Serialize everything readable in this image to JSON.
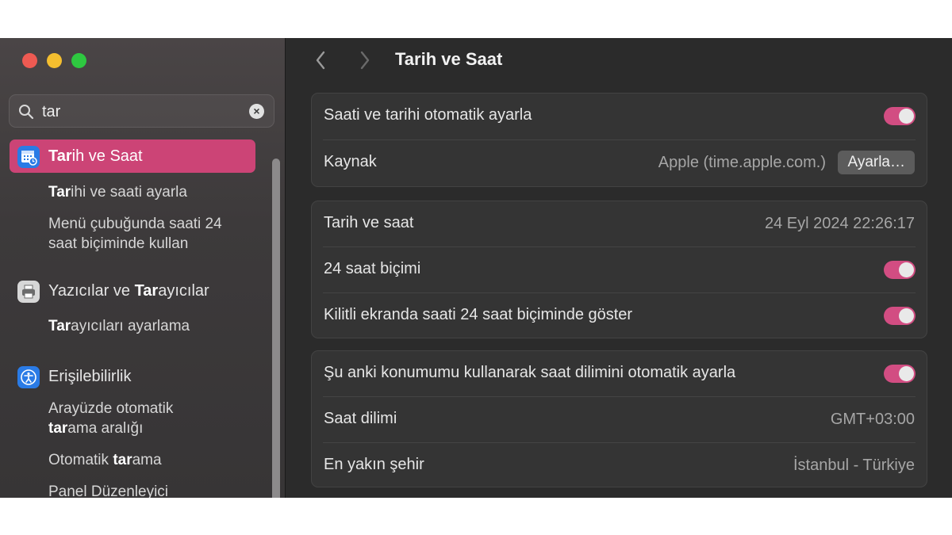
{
  "search": {
    "value": "tar"
  },
  "sidebar": {
    "items": [
      {
        "label_pre": "",
        "label_hl": "Tar",
        "label_post": "ih ve Saat",
        "icon": "calendar-clock-icon",
        "selected": true
      },
      {
        "label_pre": "Yazıcılar ve ",
        "label_hl": "Tar",
        "label_post": "ayıcılar",
        "icon": "printer-icon"
      },
      {
        "label_pre": "Erişilebilirlik",
        "label_hl": "",
        "label_post": "",
        "icon": "accessibility-icon"
      }
    ],
    "subitems": [
      {
        "pre": "",
        "hl": "Tar",
        "post": "ihi ve saati ayarla"
      },
      {
        "pre": "Menü çubuğunda saati 24",
        "hl": "",
        "post": ""
      },
      {
        "pre": "saat biçiminde kullan",
        "hl": "",
        "post": ""
      },
      {
        "pre": "",
        "hl": "Tar",
        "post": "ayıcıları ayarlama"
      },
      {
        "pre": "Arayüzde otomatik",
        "hl": "",
        "post": ""
      },
      {
        "pre": "",
        "hl": "tar",
        "post": "ama aralığı"
      },
      {
        "pre": "Otomatik ",
        "hl": "tar",
        "post": "ama"
      },
      {
        "pre": "Panel Düzenleyici",
        "hl": "",
        "post": ""
      }
    ]
  },
  "header": {
    "title": "Tarih ve Saat"
  },
  "cards": {
    "c1": {
      "auto_label": "Saati ve tarihi otomatik ayarla",
      "auto_on": true,
      "source_label": "Kaynak",
      "source_value": "Apple (time.apple.com.)",
      "source_button": "Ayarla…"
    },
    "c2": {
      "datetime_label": "Tarih ve saat",
      "datetime_value": "24 Eyl 2024 22:26:17",
      "h24_label": "24 saat biçimi",
      "h24_on": true,
      "lock_label": "Kilitli ekranda saati 24 saat biçiminde göster",
      "lock_on": true
    },
    "c3": {
      "tz_auto_label": "Şu anki konumumu kullanarak saat dilimini otomatik ayarla",
      "tz_auto_on": true,
      "tz_label": "Saat dilimi",
      "tz_value": "GMT+03:00",
      "city_label": "En yakın şehir",
      "city_value": "İstanbul - Türkiye"
    }
  },
  "colors": {
    "accent": "#cc4476",
    "toggle": "#d24d82"
  }
}
